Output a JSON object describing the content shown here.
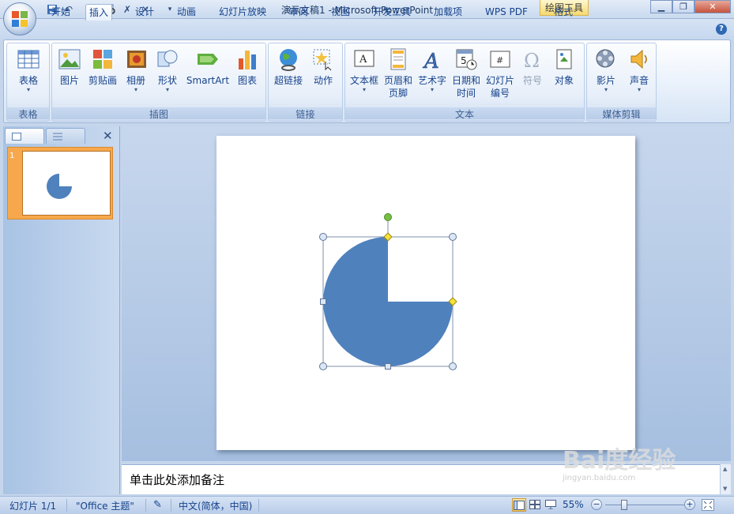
{
  "window": {
    "title": "演示文稿1 - Microsoft PowerPoint",
    "contextual_tab": "绘图工具",
    "controls": [
      "minimize-icon",
      "restore-icon",
      "close-icon"
    ]
  },
  "qat": [
    "save-icon",
    "undo-icon",
    "redo-icon",
    "preview-icon",
    "customize-icon"
  ],
  "tabs": [
    "开始",
    "插入",
    "设计",
    "动画",
    "幻灯片放映",
    "审阅",
    "视图",
    "开发工具",
    "加载项",
    "WPS PDF",
    "格式"
  ],
  "active_tab": "插入",
  "ribbon": {
    "groups": {
      "table": "表格",
      "illustrations": "插图",
      "links": "链接",
      "text": "文本",
      "media": "媒体剪辑"
    },
    "buttons": {
      "table": "表格",
      "picture": "图片",
      "clipart": "剪贴画",
      "album": "相册",
      "shapes": "形状",
      "smartart": "SmartArt",
      "chart": "图表",
      "hyperlink": "超链接",
      "action": "动作",
      "textbox": "文本框",
      "header_l1": "页眉和",
      "header_l2": "页脚",
      "wordart": "艺术字",
      "datetime_l1": "日期和",
      "datetime_l2": "时间",
      "slidenum_l1": "幻灯片",
      "slidenum_l2": "编号",
      "symbol": "符号",
      "object": "对象",
      "movie": "影片",
      "sound": "声音"
    }
  },
  "panel": {
    "slide_number": "1"
  },
  "slide": {
    "shape": "pie-three-quarter",
    "fill": "#4f81bd"
  },
  "notes": {
    "placeholder": "单击此处添加备注"
  },
  "status": {
    "slide_info": "幻灯片 1/1",
    "theme": "\"Office 主题\"",
    "language": "中文(简体，中国)",
    "zoom": "55%",
    "zoom_minus": "−",
    "zoom_plus": "+"
  },
  "watermark": "Bai度经验"
}
